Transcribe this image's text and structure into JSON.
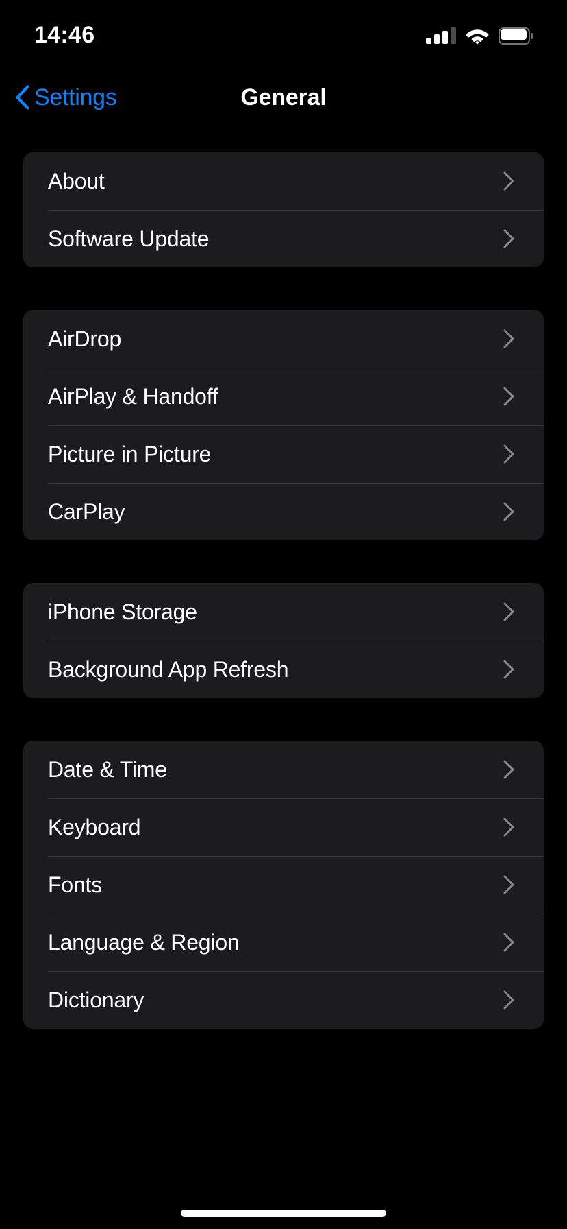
{
  "status_bar": {
    "time": "14:46",
    "cellular": {
      "icon": "cellular-signal-icon",
      "bars_filled": 3,
      "bars_total": 4
    },
    "wifi": {
      "icon": "wifi-icon",
      "strength": "full"
    },
    "battery": {
      "icon": "battery-icon",
      "level": "full"
    }
  },
  "nav": {
    "back_label": "Settings",
    "back_icon": "chevron-left-icon",
    "title": "General"
  },
  "colors": {
    "background": "#000000",
    "card": "#1c1c1e",
    "separator": "#38383a",
    "accent_blue": "#0a84ff",
    "label": "#ffffff",
    "chevron": "#8a8a8e"
  },
  "groups": [
    {
      "rows": [
        {
          "label": "About",
          "accessory": "chevron-right-icon"
        },
        {
          "label": "Software Update",
          "accessory": "chevron-right-icon"
        }
      ]
    },
    {
      "rows": [
        {
          "label": "AirDrop",
          "accessory": "chevron-right-icon"
        },
        {
          "label": "AirPlay & Handoff",
          "accessory": "chevron-right-icon"
        },
        {
          "label": "Picture in Picture",
          "accessory": "chevron-right-icon"
        },
        {
          "label": "CarPlay",
          "accessory": "chevron-right-icon"
        }
      ]
    },
    {
      "rows": [
        {
          "label": "iPhone Storage",
          "accessory": "chevron-right-icon"
        },
        {
          "label": "Background App Refresh",
          "accessory": "chevron-right-icon"
        }
      ]
    },
    {
      "rows": [
        {
          "label": "Date & Time",
          "accessory": "chevron-right-icon"
        },
        {
          "label": "Keyboard",
          "accessory": "chevron-right-icon"
        },
        {
          "label": "Fonts",
          "accessory": "chevron-right-icon"
        },
        {
          "label": "Language & Region",
          "accessory": "chevron-right-icon"
        },
        {
          "label": "Dictionary",
          "accessory": "chevron-right-icon"
        }
      ]
    }
  ],
  "home_indicator": {
    "name": "home-indicator"
  }
}
